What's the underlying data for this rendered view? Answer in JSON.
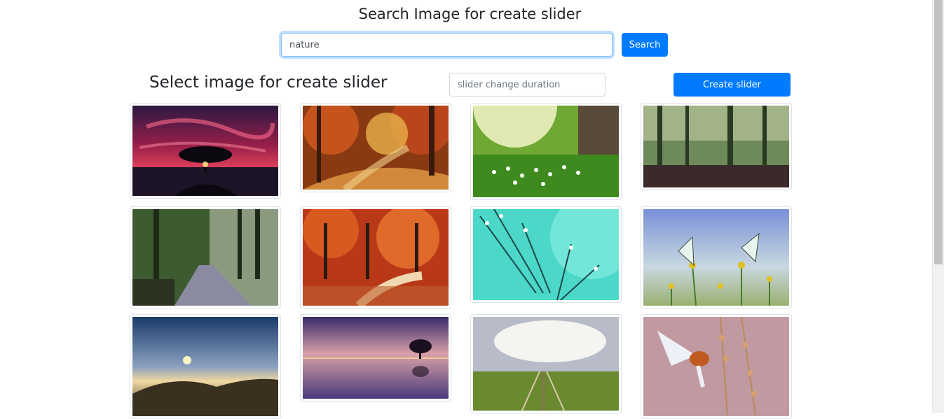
{
  "header": {
    "title": "Search Image for create slider"
  },
  "search": {
    "value": "nature",
    "button_label": "Search"
  },
  "selection": {
    "title": "Select image for create slider",
    "duration_placeholder": "slider change duration",
    "create_button_label": "Create slider"
  },
  "gallery": {
    "images": [
      {
        "subject": "tree silhouette under red sky at sunset by the sea"
      },
      {
        "subject": "autumn forest path with orange leaves"
      },
      {
        "subject": "green meadow with white daisies in sunlight"
      },
      {
        "subject": "misty green forest with tall trees"
      },
      {
        "subject": "dirt road through sunlit forest"
      },
      {
        "subject": "red autumn trees along curving path"
      },
      {
        "subject": "dandelion seeds with dew drops on turquoise"
      },
      {
        "subject": "two white butterflies on yellow wildflowers"
      },
      {
        "subject": "mountain landscape above clouds at sunset"
      },
      {
        "subject": "lone tree reflected in calm purple lake"
      },
      {
        "subject": "railway track under cloudy sky"
      },
      {
        "subject": "bird flying near dried flowers"
      }
    ]
  }
}
